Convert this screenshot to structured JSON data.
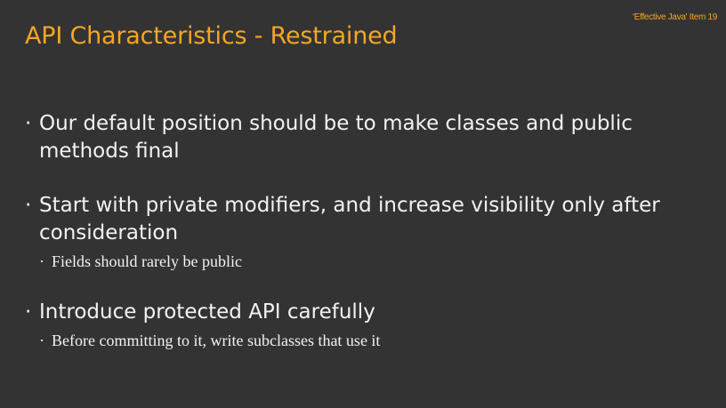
{
  "slide": {
    "corner_note": "'Effective Java' Item 19",
    "title": "API Characteristics - Restrained",
    "bullet_glyph": "·",
    "bullets": [
      {
        "text": "Our default position should be to make classes and public methods final",
        "sub": []
      },
      {
        "text": "Start with private modifiers, and increase visibility only after consideration",
        "sub": [
          "Fields should rarely be public"
        ]
      },
      {
        "text": "Introduce protected API carefully",
        "sub": [
          "Before committing to it, write subclasses that use it"
        ]
      }
    ]
  },
  "colors": {
    "background": "#333333",
    "accent": "#F5A623",
    "text": "#F2F2F2"
  }
}
